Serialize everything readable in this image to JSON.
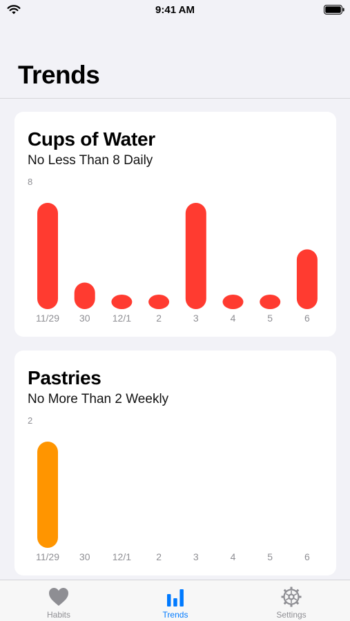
{
  "status_bar": {
    "time": "9:41 AM",
    "icons": [
      "wifi-icon",
      "battery-icon"
    ]
  },
  "page": {
    "title": "Trends"
  },
  "cards": [
    {
      "title": "Cups of Water",
      "subtitle": "No Less Than 8 Daily",
      "axis_max": "8",
      "color": "#ff3b30",
      "chart_data": {
        "type": "bar",
        "categories": [
          "11/29",
          "30",
          "12/1",
          "2",
          "3",
          "4",
          "5",
          "6"
        ],
        "values": [
          8,
          2,
          1,
          1,
          8,
          1,
          1,
          4.5
        ],
        "ylim": [
          0,
          8
        ]
      }
    },
    {
      "title": "Pastries",
      "subtitle": "No More Than 2 Weekly",
      "axis_max": "2",
      "color": "#ff9500",
      "chart_data": {
        "type": "bar",
        "categories": [
          "11/29",
          "30",
          "12/1",
          "2",
          "3",
          "4",
          "5",
          "6"
        ],
        "values": [
          2,
          0,
          0,
          0,
          0,
          0,
          0,
          0
        ],
        "ylim": [
          0,
          2
        ]
      }
    }
  ],
  "tab_bar": {
    "active_color": "#007aff",
    "inactive_color": "#8e8e93",
    "tabs": [
      {
        "label": "Habits",
        "icon": "heart-icon",
        "active": false
      },
      {
        "label": "Trends",
        "icon": "bar-chart-icon",
        "active": true
      },
      {
        "label": "Settings",
        "icon": "gear-icon",
        "active": false
      }
    ]
  }
}
